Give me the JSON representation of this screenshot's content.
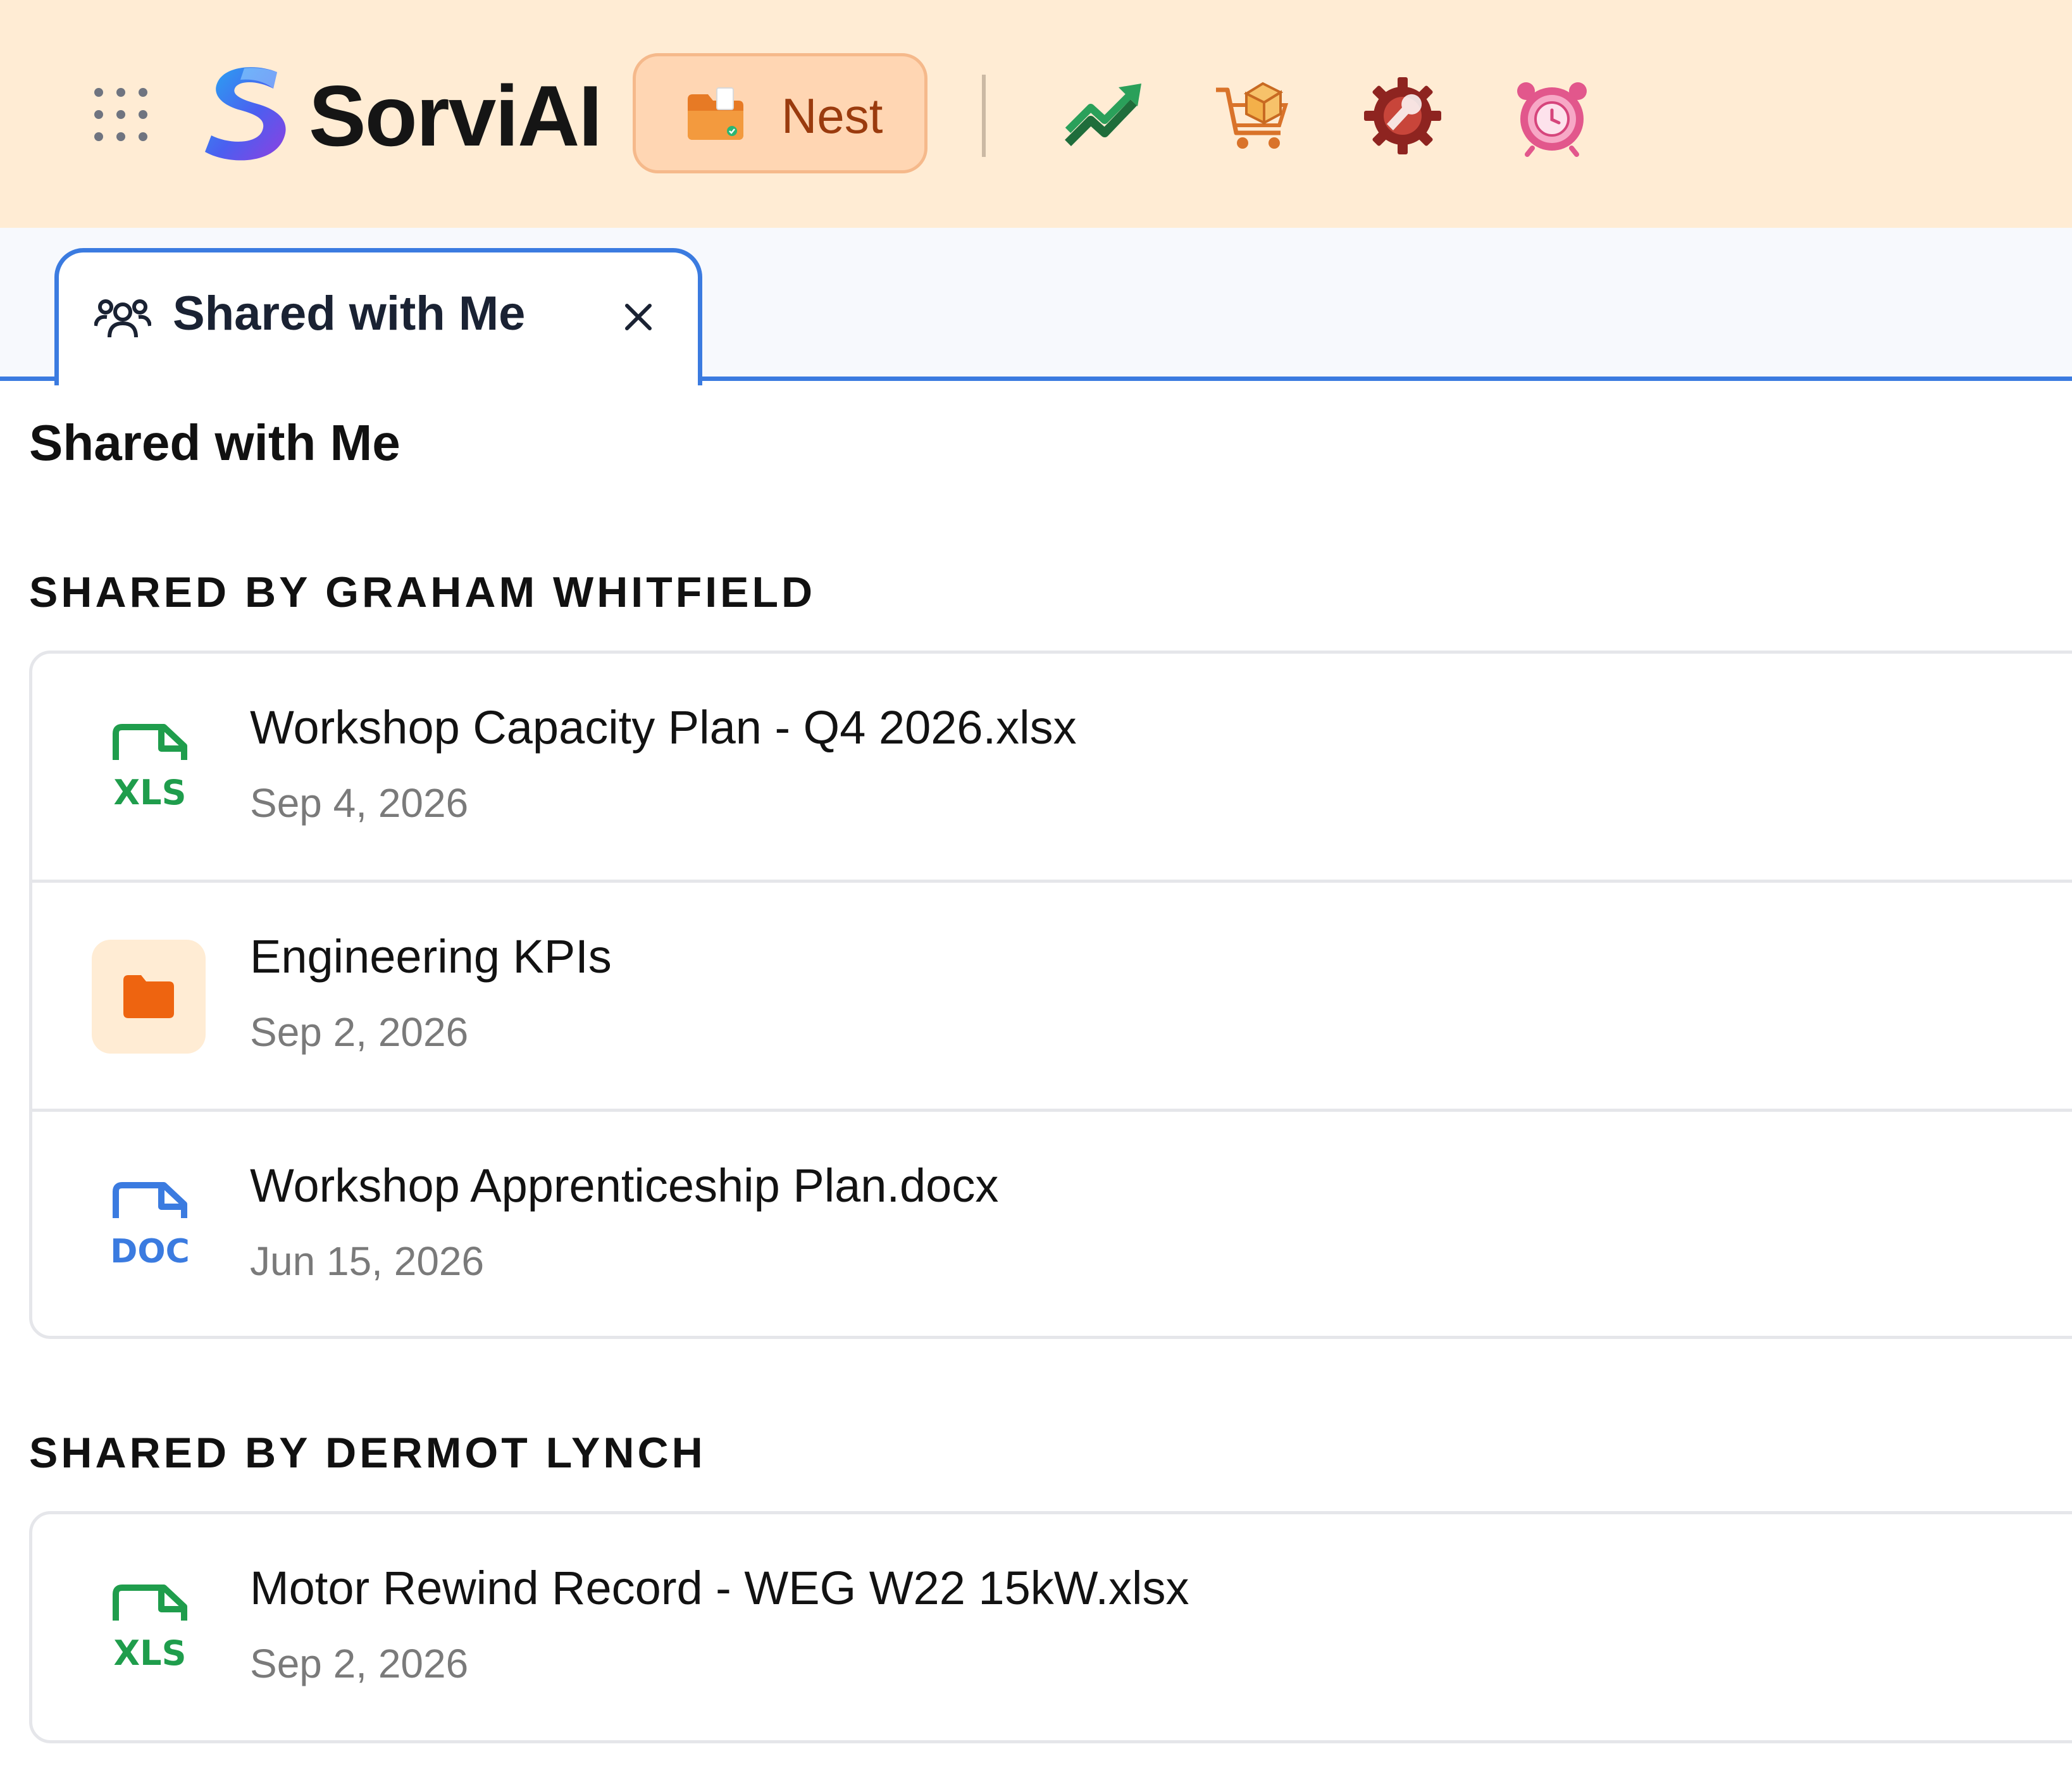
{
  "header": {
    "brand": "SorviAI",
    "active_app_label": "Nest",
    "icons": {
      "apps_grid": "apps-grid-icon",
      "logo": "sorviai-logo-icon",
      "nest": "folder-icon",
      "apps": [
        "trending-chart-icon",
        "shopping-cart-box-icon",
        "gear-wrench-icon",
        "alarm-clock-icon"
      ]
    }
  },
  "tabs": [
    {
      "label": "Shared with Me",
      "icon": "users-icon",
      "active": true
    }
  ],
  "page": {
    "title": "Shared with Me"
  },
  "groups": [
    {
      "heading": "SHARED BY GRAHAM WHITFIELD",
      "items": [
        {
          "type": "xls",
          "icon_text": "XLS",
          "name": "Workshop Capacity Plan - Q4 2026.xlsx",
          "date": "Sep 4, 2026"
        },
        {
          "type": "folder",
          "name": "Engineering KPIs",
          "date": "Sep 2, 2026"
        },
        {
          "type": "doc",
          "icon_text": "DOC",
          "name": "Workshop Apprenticeship Plan.docx",
          "date": "Jun 15, 2026"
        }
      ]
    },
    {
      "heading": "SHARED BY DERMOT LYNCH",
      "items": [
        {
          "type": "xls",
          "icon_text": "XLS",
          "name": "Motor Rewind Record - WEG W22 15kW.xlsx",
          "date": "Sep 2, 2026"
        }
      ]
    }
  ],
  "colors": {
    "header_bg": "#ffecd4",
    "accent_blue": "#3b7be0",
    "xls_green": "#1f9d4c",
    "doc_blue": "#3b7be0",
    "folder_orange": "#ee6410",
    "nest_text": "#9a3b0e"
  }
}
